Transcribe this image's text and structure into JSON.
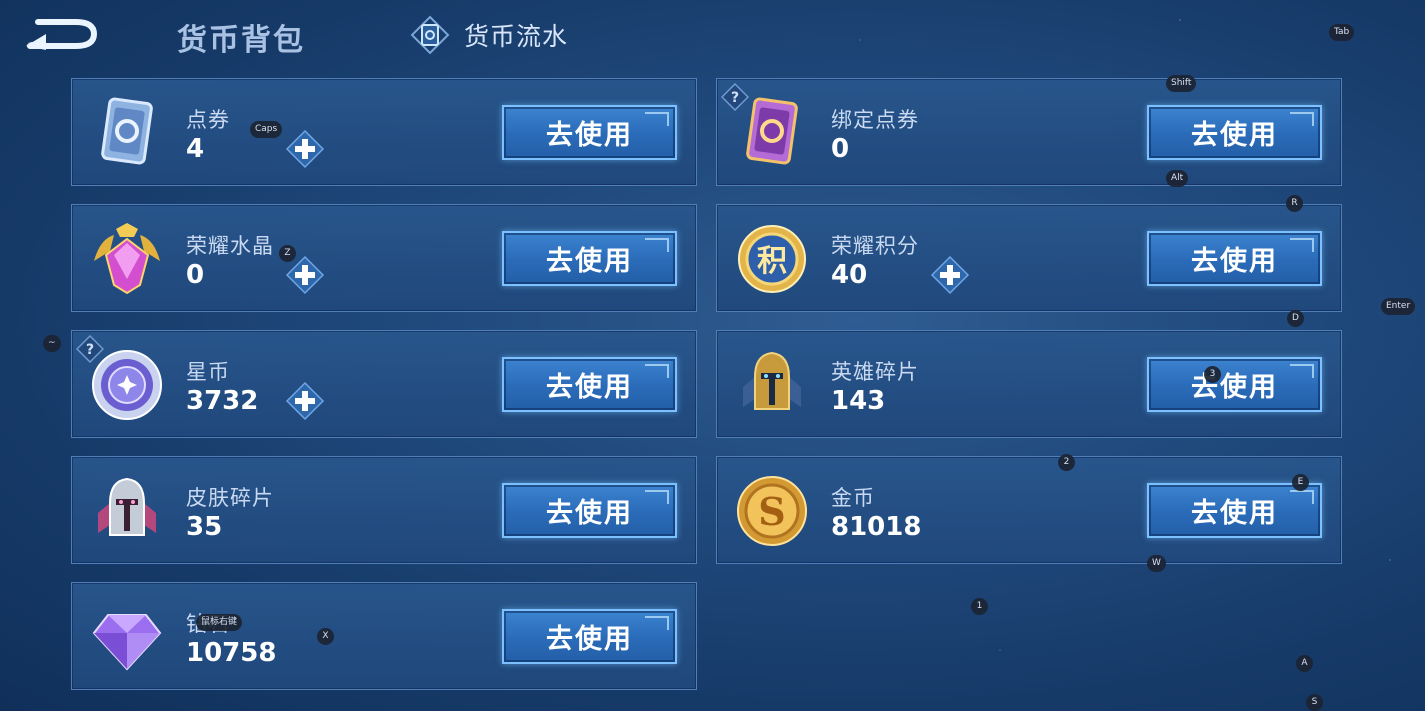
{
  "header": {
    "back_icon": "back-arrow-icon",
    "title": "货币背包",
    "flow_tab_icon": "ledger-diamond-icon",
    "flow_tab_label": "货币流水"
  },
  "colors": {
    "accent": "#7cc0ff",
    "panel": "#28568c",
    "button": "#2a6bb8"
  },
  "currencies": [
    {
      "name": "点券",
      "amount": "4",
      "icon": "voucher-card-icon",
      "has_plus": true,
      "has_help": false,
      "button": "去使用"
    },
    {
      "name": "绑定点券",
      "amount": "0",
      "icon": "bound-voucher-card-icon",
      "has_plus": false,
      "has_help": true,
      "button": "去使用"
    },
    {
      "name": "荣耀水晶",
      "amount": "0",
      "icon": "glory-crystal-icon",
      "has_plus": true,
      "has_help": false,
      "button": "去使用"
    },
    {
      "name": "荣耀积分",
      "amount": "40",
      "icon": "glory-points-coin-icon",
      "coin_glyph": "积",
      "has_plus": true,
      "has_help": false,
      "button": "去使用"
    },
    {
      "name": "星币",
      "amount": "3732",
      "icon": "star-coin-icon",
      "has_plus": true,
      "has_help": true,
      "button": "去使用"
    },
    {
      "name": "英雄碎片",
      "amount": "143",
      "icon": "hero-fragment-icon",
      "has_plus": false,
      "has_help": false,
      "button": "去使用"
    },
    {
      "name": "皮肤碎片",
      "amount": "35",
      "icon": "skin-fragment-icon",
      "has_plus": false,
      "has_help": false,
      "button": "去使用"
    },
    {
      "name": "金币",
      "amount": "81018",
      "icon": "gold-coin-icon",
      "coin_glyph": "S",
      "has_plus": false,
      "has_help": false,
      "button": "去使用"
    },
    {
      "name": "钻石",
      "amount": "10758",
      "icon": "diamond-gem-icon",
      "has_plus": false,
      "has_help": false,
      "button": "去使用"
    }
  ],
  "key_hints": [
    "Tab",
    "Shift",
    "Caps",
    "Alt",
    "R",
    "Z",
    "Enter",
    "D",
    "~",
    "3",
    "2",
    "E",
    "W",
    "鼠标右键",
    "X",
    "1",
    "A",
    "S"
  ]
}
